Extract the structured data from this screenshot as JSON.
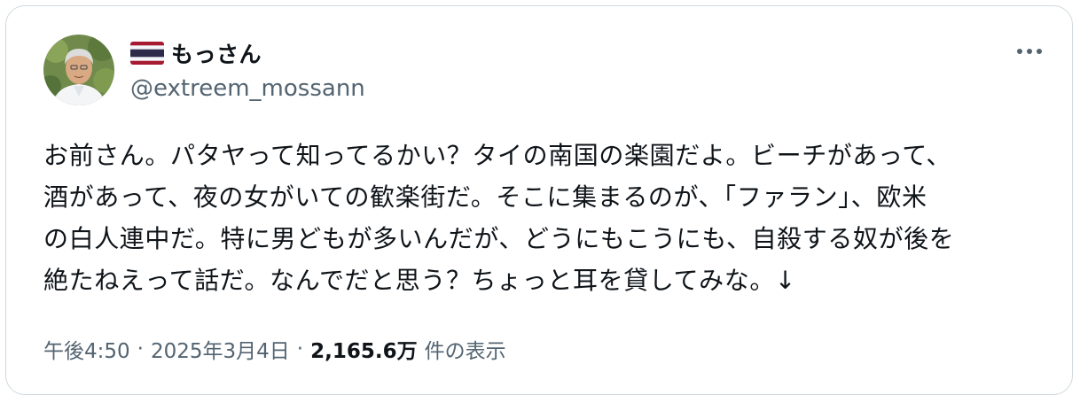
{
  "author": {
    "display_name": "もっさん",
    "handle": "@extreem_mossann",
    "flag": "thailand-flag"
  },
  "tweet": {
    "lines": [
      "お前さん。パタヤって知ってるかい？タイの南国の楽園だよ。ビーチがあって、",
      "酒があって、夜の女がいての歓楽街だ。そこに集まるのが、「ファラン」、欧米",
      "の白人連中だ。特に男どもが多いんだが、どうにもこうにも、自殺する奴が後を",
      "絶たねえって話だ。なんでだと思う？ちょっと耳を貸してみな。↓"
    ]
  },
  "meta": {
    "time": "午後4:50",
    "separator": "·",
    "date": "2025年3月4日",
    "views_count": "2,165.6万",
    "views_label": "件の表示"
  },
  "colors": {
    "text": "#0f1419",
    "secondary": "#536471",
    "border": "#cfd9de"
  }
}
